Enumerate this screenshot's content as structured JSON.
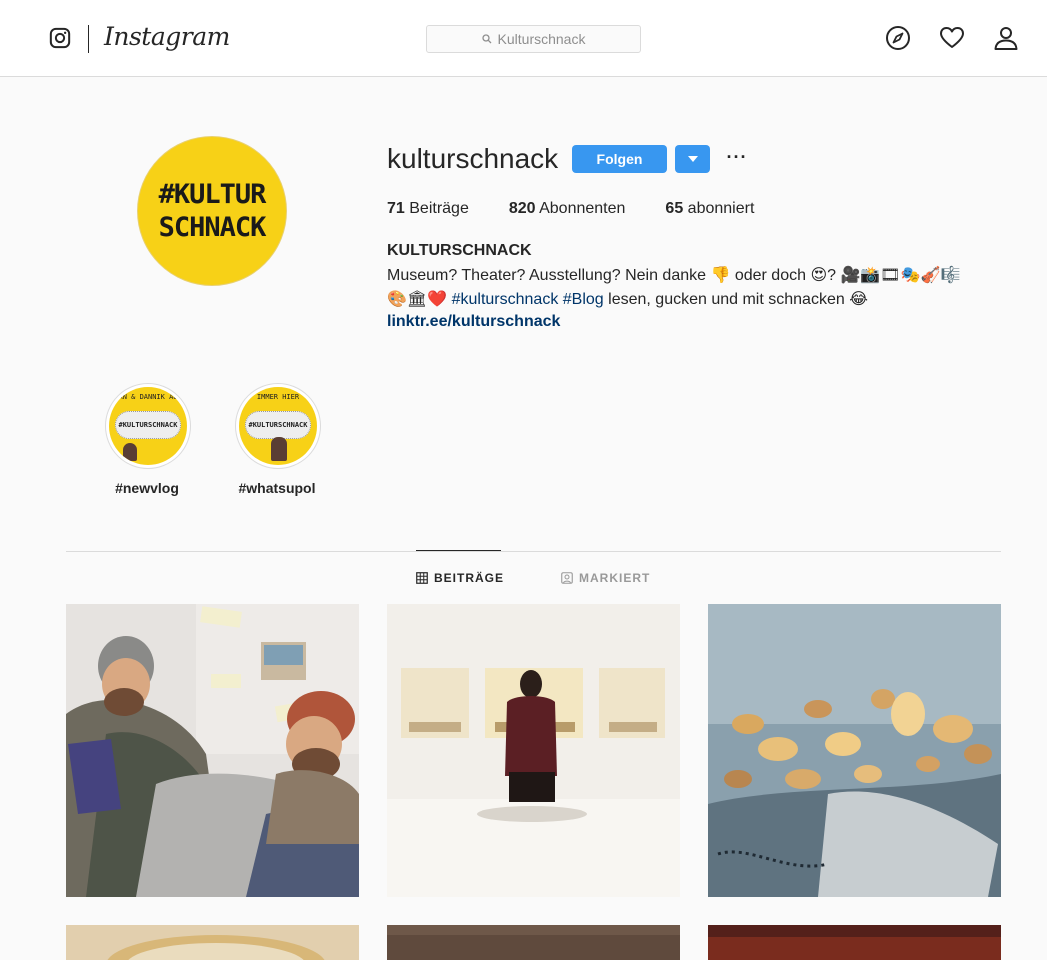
{
  "header": {
    "wordmark": "Instagram",
    "search_value": "Kulturschnack"
  },
  "profile": {
    "username": "kulturschnack",
    "follow_label": "Folgen",
    "more_label": "···",
    "avatar_line1": "#KULTUR",
    "avatar_line2": "SCHNACK",
    "stats": {
      "posts_count": "71",
      "posts_label": "Beiträge",
      "followers_count": "820",
      "followers_label": "Abonnenten",
      "following_count": "65",
      "following_label": "abonniert"
    },
    "bio_name": "KULTURSCHNACK",
    "bio_line1": "Museum? Theater? Ausstellung? Nein danke 👎 oder doch 😍? 🎥📸🎞🎭🎻🎼",
    "bio_line2_prefix": "🎨🏛❤️",
    "bio_tag1": "#kulturschnack",
    "bio_tag2": "#Blog",
    "bio_line2_suffix": "lesen, gucken und mit schnacken 😂",
    "link": "linktr.ee/kulturschnack"
  },
  "highlights": [
    {
      "label": "#newvlog",
      "top_text": "JAN & DANNIK AUF",
      "center_text": "#KULTURSCHNACK"
    },
    {
      "label": "#whatsupol",
      "top_text": "IMMER HIER",
      "center_text": "#KULTURSCHNACK"
    }
  ],
  "tabs": {
    "posts": "BEITRÄGE",
    "tagged": "MARKIERT"
  },
  "posts": [
    {
      "name": "post-1-two-men-reading"
    },
    {
      "name": "post-2-museum-visitor"
    },
    {
      "name": "post-3-hanging-stones"
    },
    {
      "name": "post-4"
    },
    {
      "name": "post-5"
    },
    {
      "name": "post-6"
    }
  ]
}
